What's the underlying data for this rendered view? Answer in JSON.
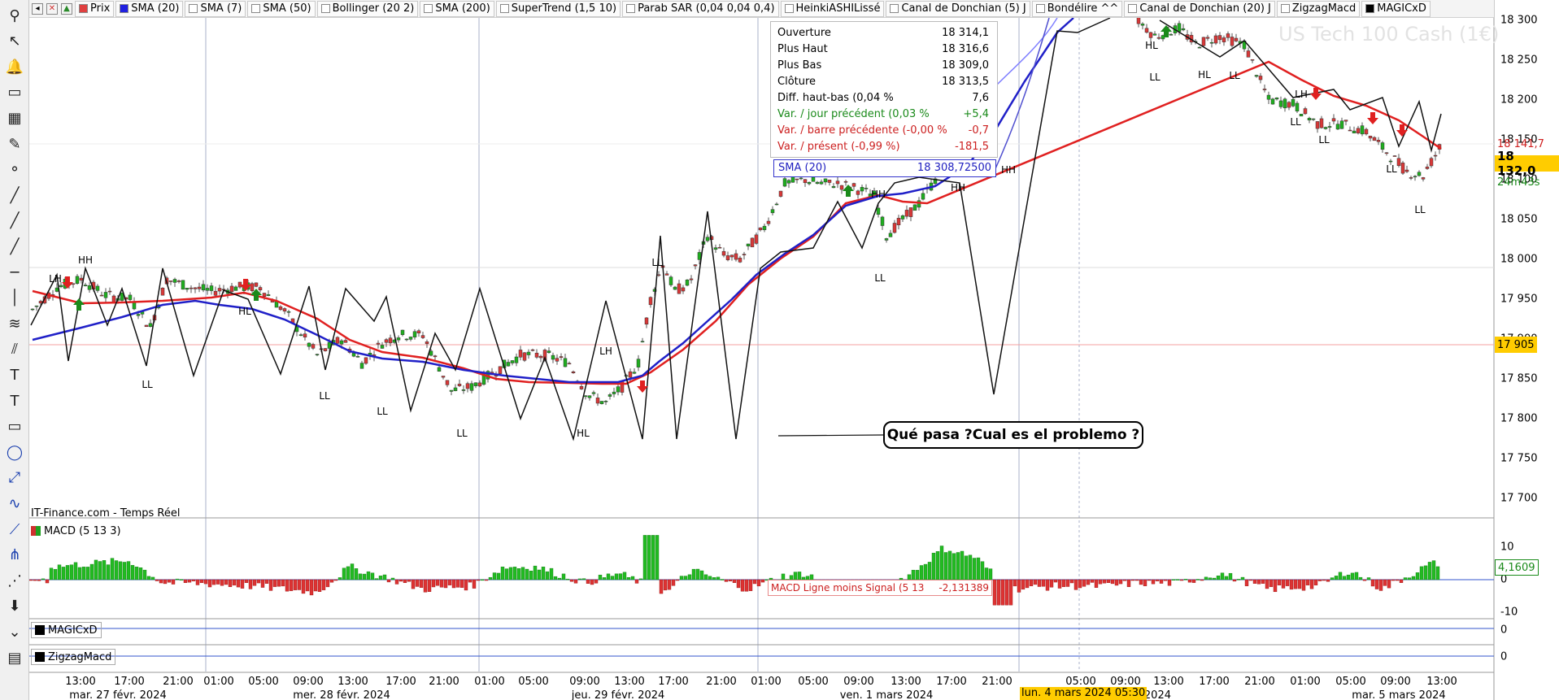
{
  "toolbar": {
    "chips": [
      {
        "label": "Prix",
        "color": "#e04040"
      },
      {
        "label": "SMA (20)",
        "color": "#2020e0"
      },
      {
        "label": "SMA (7)",
        "color": "#ffffff"
      },
      {
        "label": "SMA (50)",
        "color": "#ffffff"
      },
      {
        "label": "Bollinger (20 2)",
        "color": "#ffffff"
      },
      {
        "label": "SMA (200)",
        "color": "#ffffff"
      },
      {
        "label": "SuperTrend (1,5 10)",
        "color": "#ffffff"
      },
      {
        "label": "Parab SAR (0,04 0,04 0,4)",
        "color": "#ffffff"
      },
      {
        "label": "HeinkiASHILissé",
        "color": "#ffffff"
      },
      {
        "label": "Canal de Donchian (5) J",
        "color": "#ffffff"
      },
      {
        "label": "Bondélire ^^",
        "color": "#ffffff"
      },
      {
        "label": "Canal de Donchian (20) J",
        "color": "#ffffff"
      },
      {
        "label": "ZigzagMacd",
        "color": "#ffffff"
      },
      {
        "label": "MAGICxD",
        "color": "#000000"
      }
    ]
  },
  "instrument": {
    "name": "US Tech 100 Cash (1€)",
    "source": "IT-Finance.com - Temps Réel"
  },
  "price_axis": {
    "ticks": [
      "18 300",
      "18 250",
      "18 200",
      "18 150",
      "18 100",
      "18 050",
      "18 000",
      "17 950",
      "17 900",
      "17 850",
      "17 800",
      "17 750",
      "17 700"
    ],
    "current_price": "18 132,0",
    "countdown": "24m43s",
    "level_top": "18 141,7",
    "level_red": "17 905"
  },
  "info_box": {
    "rows": [
      {
        "label": "Ouverture",
        "value": "18 314,1",
        "color": "#000000"
      },
      {
        "label": "Plus Haut",
        "value": "18 316,6",
        "color": "#000000"
      },
      {
        "label": "Plus Bas",
        "value": "18 309,0",
        "color": "#000000"
      },
      {
        "label": "Clôture",
        "value": "18 313,5",
        "color": "#000000"
      },
      {
        "label": "Diff. haut-bas (0,04 %",
        "value": "7,6",
        "color": "#000000"
      },
      {
        "label": "Var. / jour précédent (0,03 %",
        "value": "+5,4",
        "color": "#1a8a1a"
      },
      {
        "label": "Var. / barre précédente (-0,00 %",
        "value": "-0,7",
        "color": "#cc2020"
      },
      {
        "label": "Var. / présent (-0,99 %)",
        "value": "-181,5",
        "color": "#cc2020"
      }
    ],
    "sma_label": "SMA (20)",
    "sma_value": "18 308,72500"
  },
  "annotation": "Qué pasa ?Cual es el problemo ?",
  "zigzag_labels": [
    "HH",
    "LH",
    "LL",
    "HL",
    "LL",
    "LL",
    "LL",
    "HL",
    "LH",
    "LL",
    "HH",
    "HH",
    "HH",
    "HL",
    "LL",
    "HL",
    "LL",
    "LL",
    "LH",
    "LL",
    "LL",
    "LL",
    "LL"
  ],
  "macd": {
    "label": "MACD (5 13 3)",
    "signal_readout": "MACD Ligne moins Signal (5 13",
    "signal_value": "-2,131389",
    "current": "4,1609",
    "ticks": [
      "10",
      "0",
      "-10"
    ]
  },
  "sub_panes": [
    {
      "label": "MAGICxD",
      "zero": "0"
    },
    {
      "label": "ZigzagMacd",
      "zero": "0"
    }
  ],
  "time_axis": {
    "times": [
      "13:00",
      "17:00",
      "21:00",
      "01:00",
      "05:00",
      "09:00",
      "13:00",
      "17:00",
      "21:00",
      "01:00",
      "05:00",
      "09:00",
      "13:00",
      "17:00",
      "21:00",
      "01:00",
      "05:00",
      "09:00",
      "13:00",
      "17:00",
      "21:00",
      "05:00",
      "09:00",
      "13:00",
      "17:00",
      "21:00",
      "01:00",
      "05:00",
      "09:00",
      "13:00"
    ],
    "dates": [
      "mar. 27 févr. 2024",
      "mer. 28 févr. 2024",
      "jeu. 29 févr. 2024",
      "ven. 1 mars 2024",
      "mars 2024",
      "mar. 5 mars 2024"
    ],
    "cursor_date": "lun. 4 mars 2024 05:30"
  }
}
